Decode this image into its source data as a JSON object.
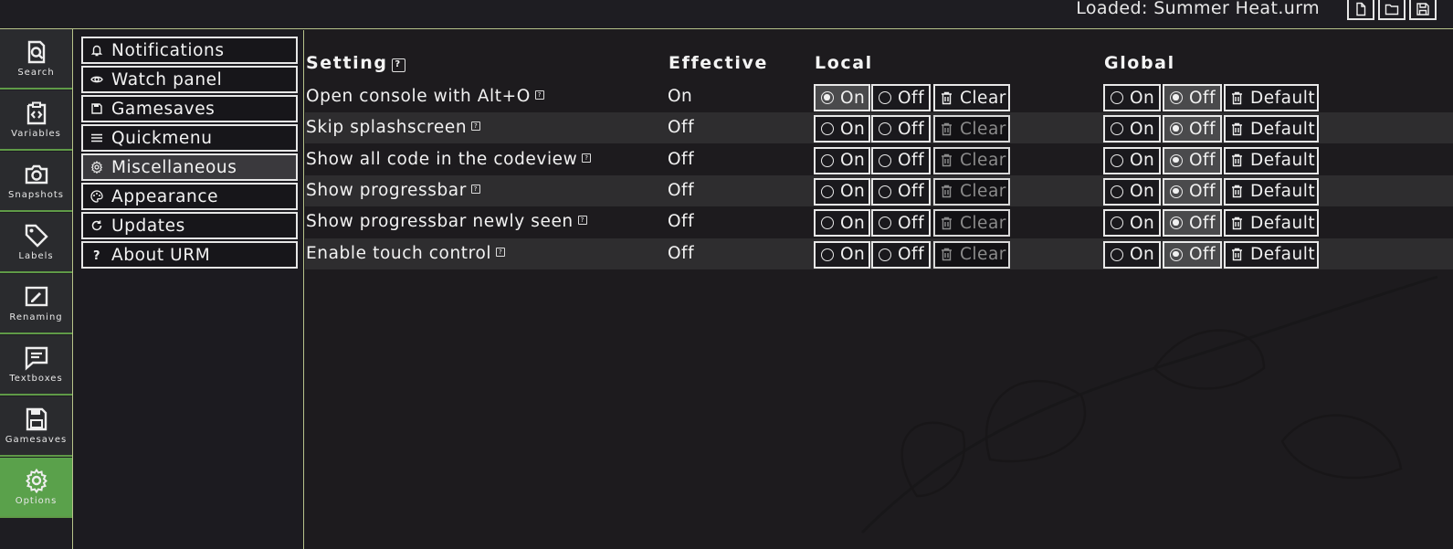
{
  "topbar": {
    "loaded_text": "Loaded: Summer Heat.urm",
    "buttons": [
      "new-file-icon",
      "open-folder-icon",
      "save-icon"
    ]
  },
  "iconbar": [
    {
      "label": "Search",
      "icon": "search-icon",
      "active": false
    },
    {
      "label": "Variables",
      "icon": "variables-icon",
      "active": false
    },
    {
      "label": "Snapshots",
      "icon": "camera-icon",
      "active": false
    },
    {
      "label": "Labels",
      "icon": "tag-icon",
      "active": false
    },
    {
      "label": "Renaming",
      "icon": "rename-icon",
      "active": false
    },
    {
      "label": "Textboxes",
      "icon": "textbox-icon",
      "active": false
    },
    {
      "label": "Gamesaves",
      "icon": "floppy-icon",
      "active": false
    },
    {
      "label": "Options",
      "icon": "gear-icon",
      "active": true
    }
  ],
  "menu": [
    {
      "label": "Notifications",
      "icon": "bell-icon",
      "active": false
    },
    {
      "label": "Watch panel",
      "icon": "eye-icon",
      "active": false
    },
    {
      "label": "Gamesaves",
      "icon": "floppy-icon",
      "active": false
    },
    {
      "label": "Quickmenu",
      "icon": "menu-icon",
      "active": false
    },
    {
      "label": "Miscellaneous",
      "icon": "gear-icon",
      "active": true
    },
    {
      "label": "Appearance",
      "icon": "palette-icon",
      "active": false
    },
    {
      "label": "Updates",
      "icon": "refresh-icon",
      "active": false
    },
    {
      "label": "About URM",
      "icon": "question-icon",
      "active": false
    }
  ],
  "table": {
    "headers": {
      "setting": "Setting",
      "effective": "Effective",
      "local": "Local",
      "global": "Global"
    },
    "help_glyph": "?",
    "option_labels": {
      "on": "On",
      "off": "Off",
      "clear": "Clear",
      "default": "Default"
    },
    "rows": [
      {
        "name": "Open console with Alt+O",
        "effective": "On",
        "local": "on",
        "local_clear_enabled": true,
        "global": "off"
      },
      {
        "name": "Skip splashscreen",
        "effective": "Off",
        "local": "none",
        "local_clear_enabled": false,
        "global": "off"
      },
      {
        "name": "Show all code in the codeview",
        "effective": "Off",
        "local": "none",
        "local_clear_enabled": false,
        "global": "off"
      },
      {
        "name": "Show progressbar",
        "effective": "Off",
        "local": "none",
        "local_clear_enabled": false,
        "global": "off"
      },
      {
        "name": "Show progressbar newly seen",
        "effective": "Off",
        "local": "none",
        "local_clear_enabled": false,
        "global": "off"
      },
      {
        "name": "Enable touch control",
        "effective": "Off",
        "local": "none",
        "local_clear_enabled": false,
        "global": "off"
      }
    ]
  },
  "colors": {
    "accent_green": "#5aa14b",
    "border_line": "#b7c38a",
    "background": "#1c1a1f"
  }
}
